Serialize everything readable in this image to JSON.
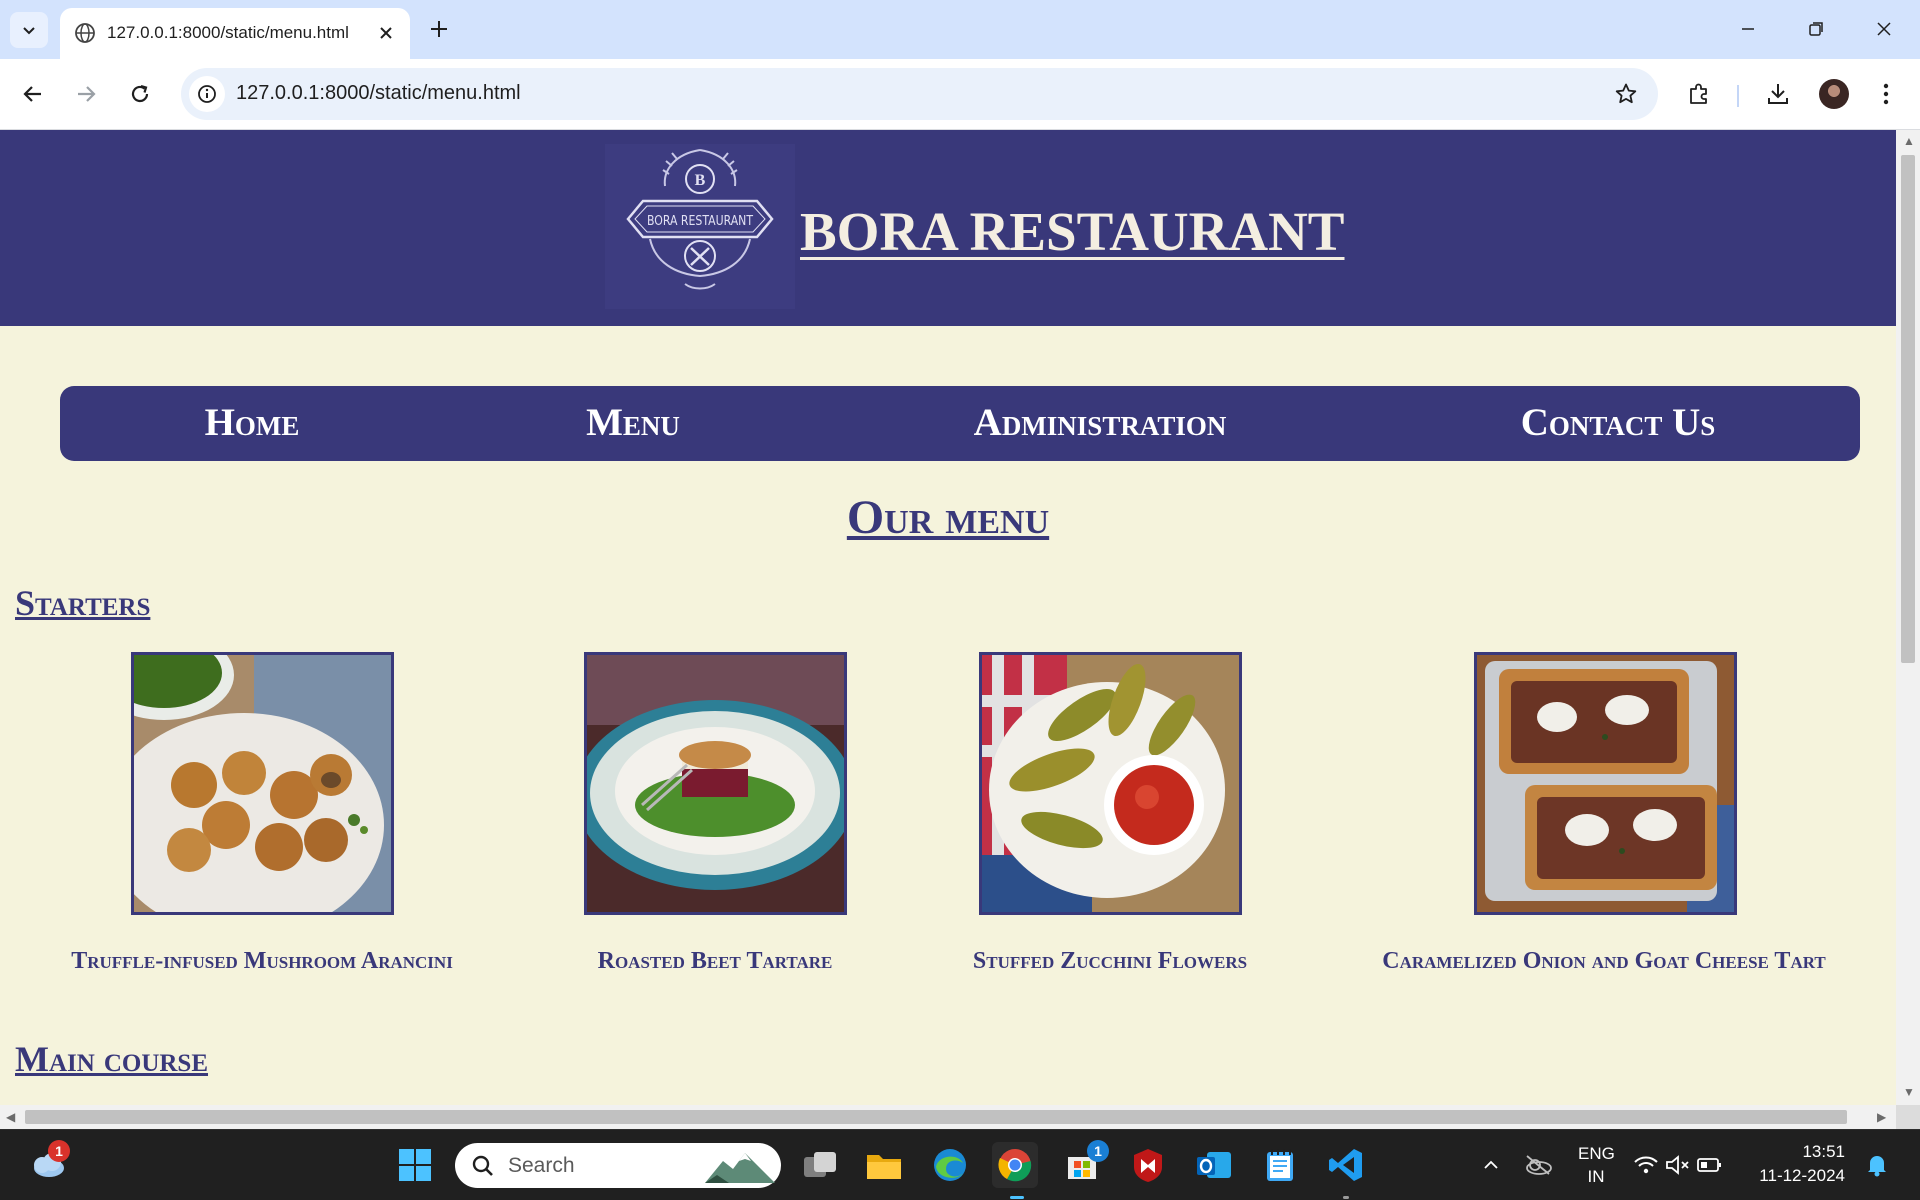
{
  "browser": {
    "tab_title": "127.0.0.1:8000/static/menu.html",
    "url": "127.0.0.1:8000/static/menu.html"
  },
  "site": {
    "logo_text": "BORA RESTAURANT",
    "logo_letter": "B",
    "title": "BORA RESTAURANT"
  },
  "nav": {
    "items": [
      {
        "label": "Home"
      },
      {
        "label": "Menu"
      },
      {
        "label": "Administration"
      },
      {
        "label": "Contact Us"
      }
    ]
  },
  "page": {
    "heading": "Our menu",
    "sections": [
      {
        "title": "Starters",
        "dishes": [
          {
            "name": "Truffle-infused Mushroom Arancini"
          },
          {
            "name": "Roasted Beet Tartare"
          },
          {
            "name": "Stuffed Zucchini Flowers"
          },
          {
            "name": "Caramelized Onion and Goat Cheese Tart"
          }
        ]
      },
      {
        "title": "Main course"
      }
    ]
  },
  "taskbar": {
    "search_placeholder": "Search",
    "weather_badge": "1",
    "store_badge": "1",
    "language": "ENG",
    "region": "IN",
    "time": "13:51",
    "date": "11-12-2024"
  },
  "colors": {
    "brand": "#39387a",
    "page_background": "#f5f3dc",
    "title_text": "#f4eee1"
  }
}
